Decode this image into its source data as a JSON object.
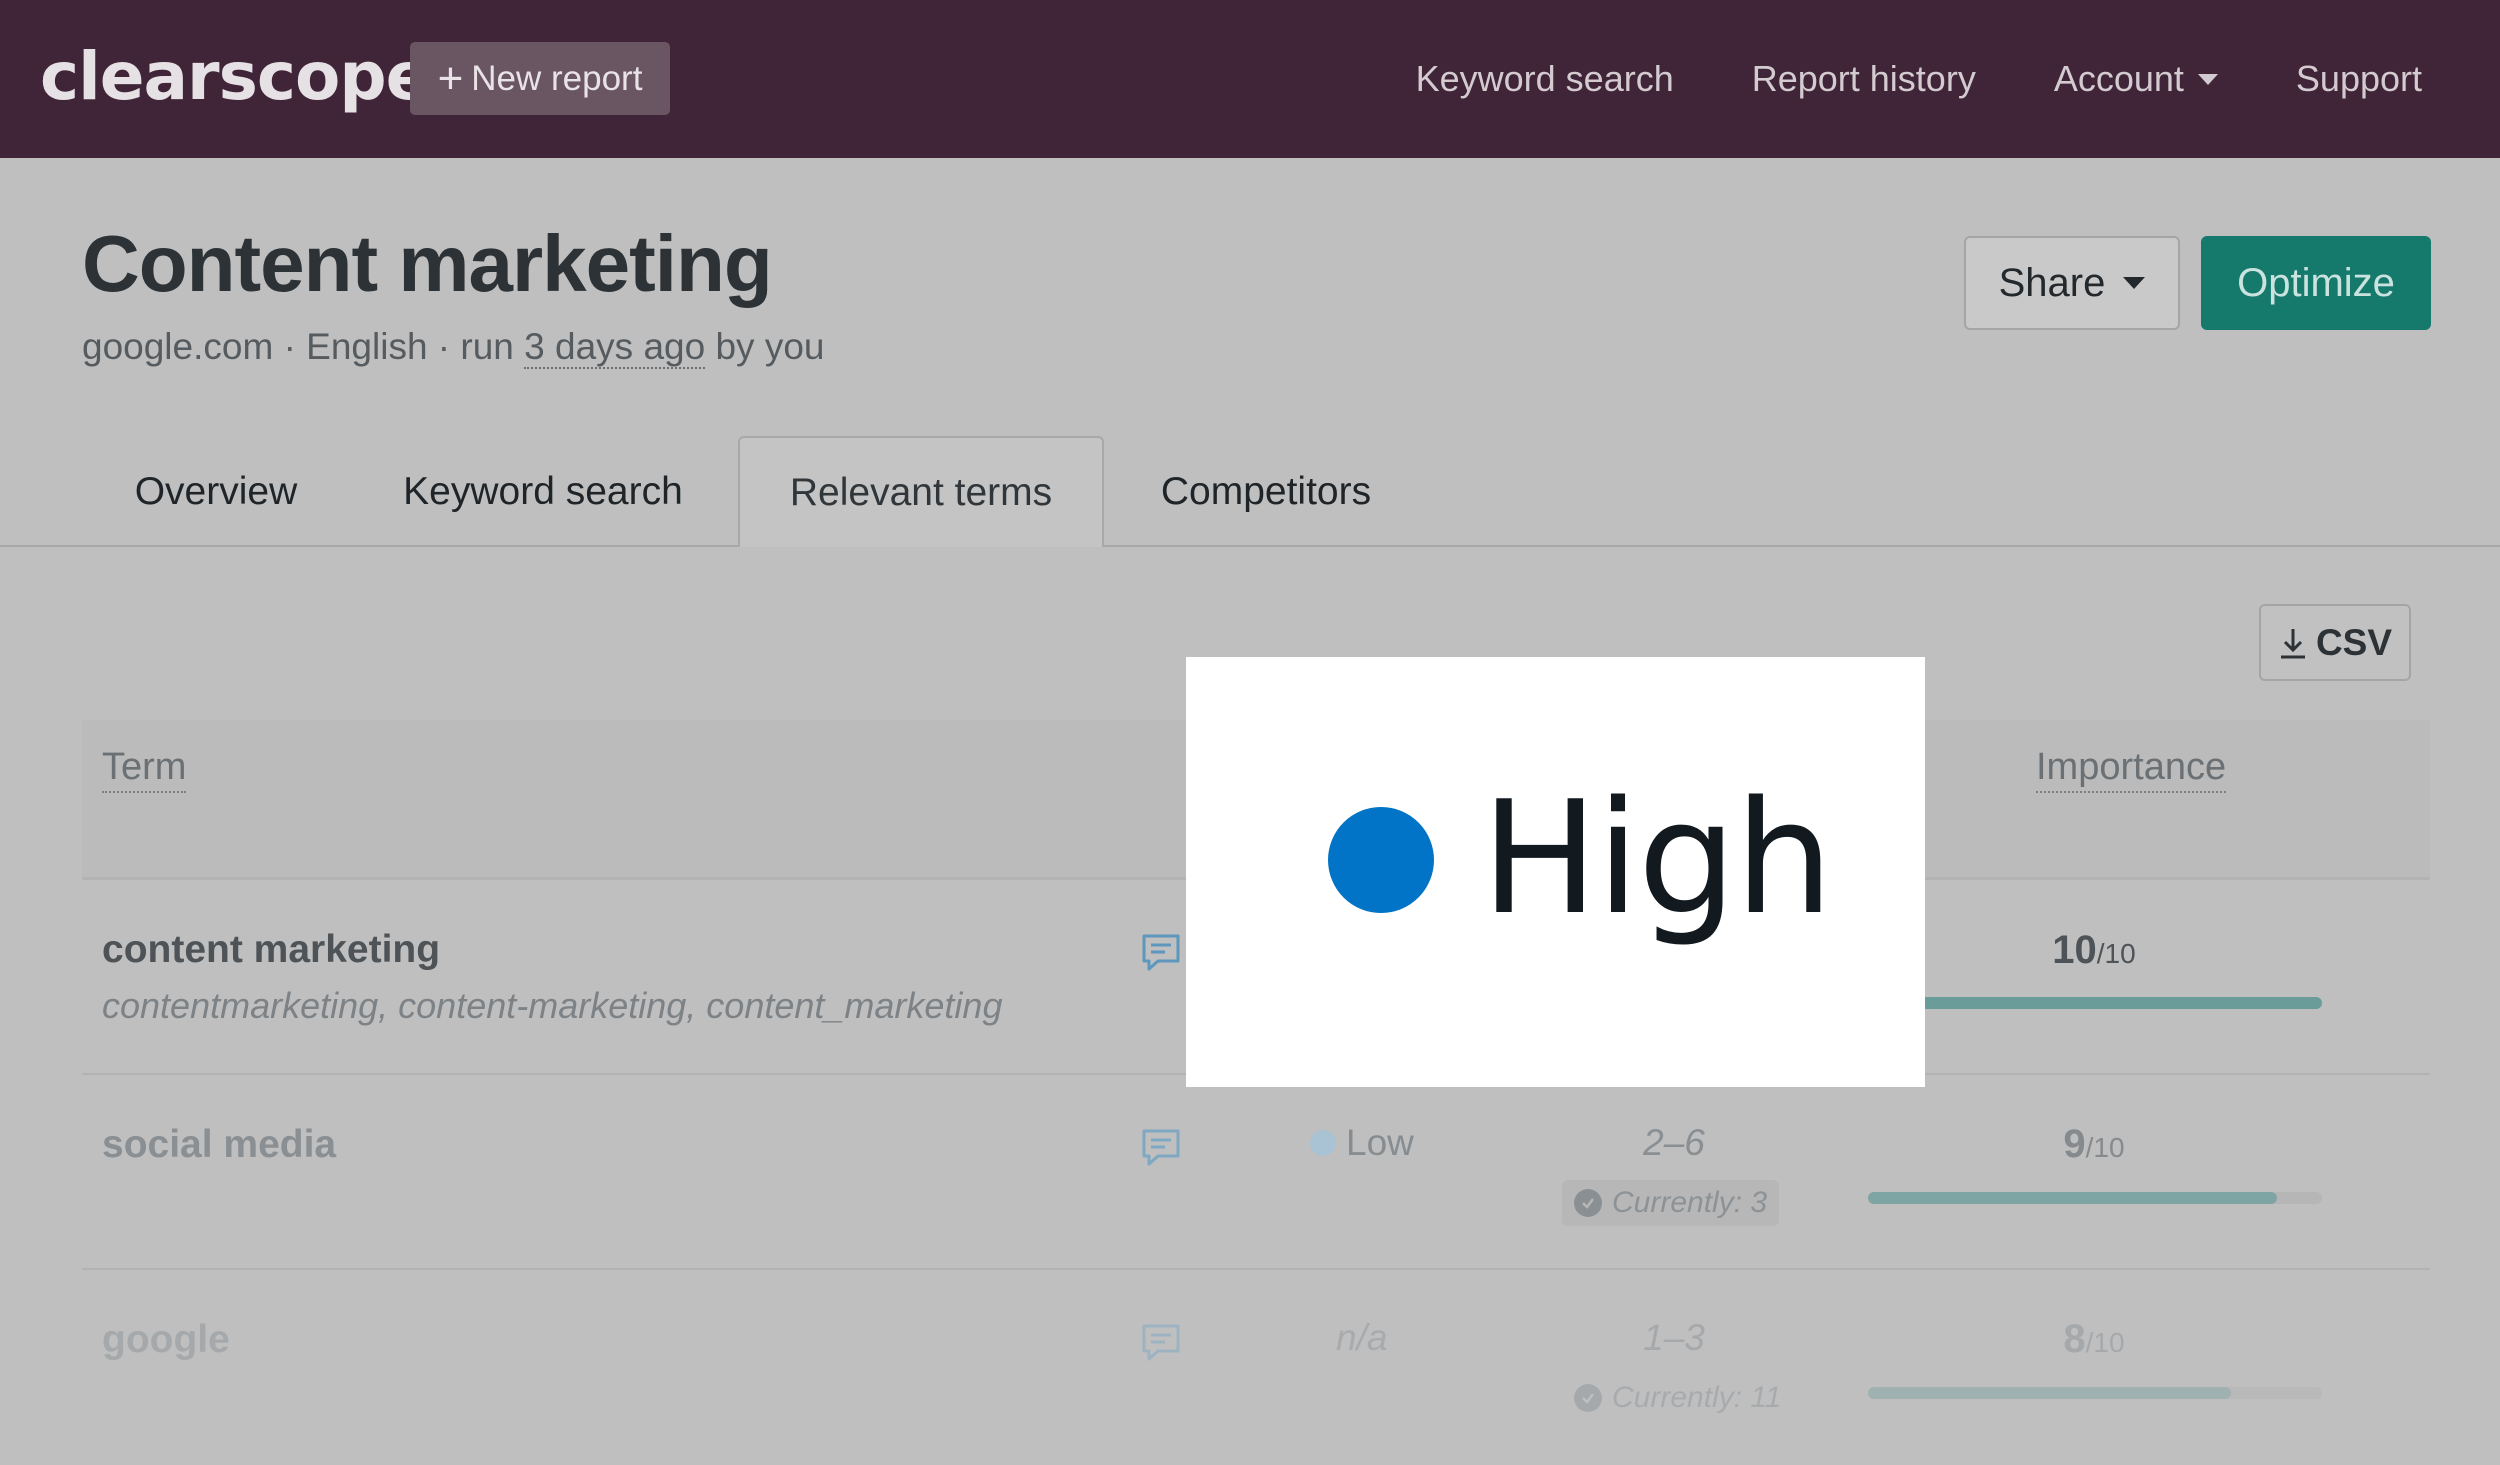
{
  "nav": {
    "logo": "clearscope",
    "new_report_plus": "+",
    "new_report": "New report",
    "links": [
      "Keyword search",
      "Report history",
      "Account",
      "Support"
    ]
  },
  "header": {
    "title": "Content marketing",
    "meta_prefix": "google.com · English · run",
    "meta_time": "3 days ago",
    "meta_suffix": "by you",
    "share": "Share",
    "optimize": "Optimize"
  },
  "tabs": [
    "Overview",
    "Keyword search",
    "Relevant terms",
    "Competitors"
  ],
  "active_tab": "Relevant terms",
  "csv": "CSV",
  "table": {
    "headers": {
      "term": "Term",
      "importance": "Importance"
    },
    "rows": [
      {
        "term": "content marketing",
        "variants": "contentmarketing, content-marketing, content_marketing",
        "importance": "10",
        "importance_of": "/10",
        "importance_fraction": 1.0
      },
      {
        "term": "social media",
        "level": "Low",
        "range": "2–6",
        "currently": "Currently: 3",
        "importance": "9",
        "importance_of": "/10",
        "importance_fraction": 0.9
      },
      {
        "term": "google",
        "level": "n/a",
        "range": "1–3",
        "currently": "Currently: 11",
        "importance": "8",
        "importance_of": "/10",
        "importance_fraction": 0.8
      }
    ]
  },
  "zoom": {
    "label": "High",
    "dot_color": "#0274c8"
  },
  "colors": {
    "nav_bg": "#3f2537",
    "optimize": "#15796c",
    "bar_fill": "#6a9c99",
    "low_dot": "#a9c3d4",
    "check": "#7a7f83"
  }
}
